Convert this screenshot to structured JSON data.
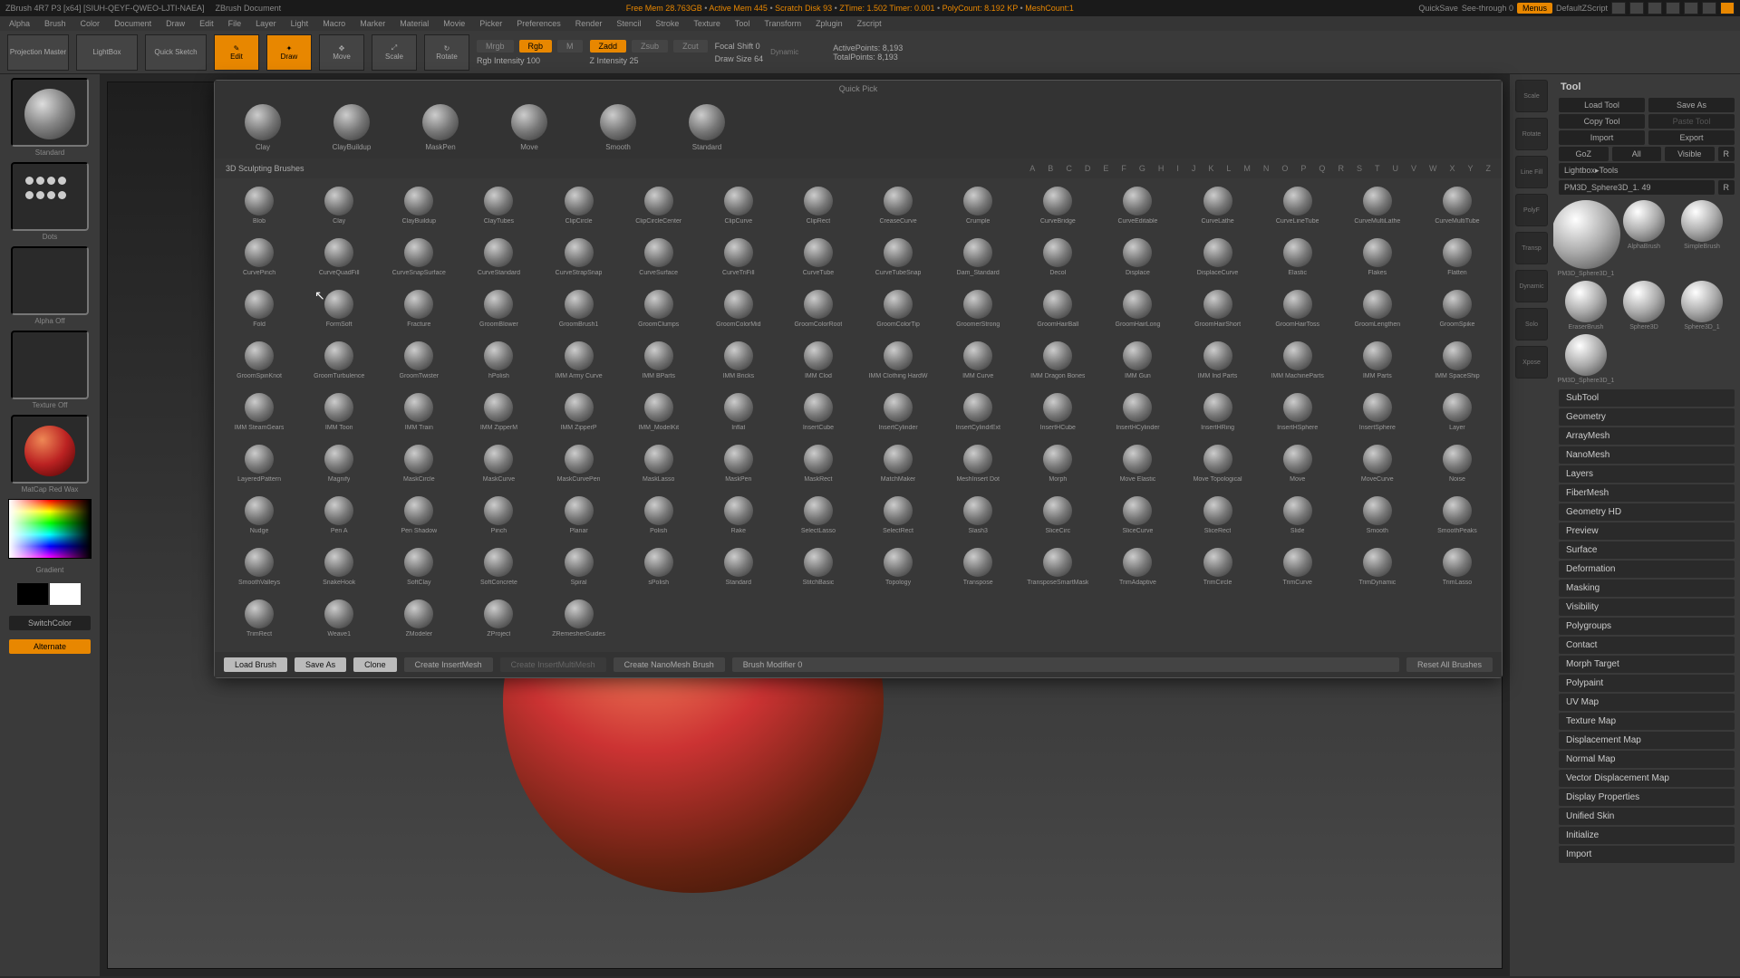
{
  "topbar": {
    "title": "ZBrush 4R7 P3 [x64] [SIUH-QEYF-QWEO-LJTI-NAEA]",
    "doc": "ZBrush Document",
    "stats": [
      "Free Mem 28.763GB",
      "Active Mem 445",
      "Scratch Disk 93",
      "ZTime: 1.502 Timer: 0.001",
      "PolyCount: 8.192 KP",
      "MeshCount:1"
    ],
    "quicksave": "QuickSave",
    "seethrough": "See-through   0",
    "menus": "Menus",
    "script": "DefaultZScript"
  },
  "menubar": [
    "Alpha",
    "Brush",
    "Color",
    "Document",
    "Draw",
    "Edit",
    "File",
    "Layer",
    "Light",
    "Macro",
    "Marker",
    "Material",
    "Movie",
    "Picker",
    "Preferences",
    "Render",
    "Stencil",
    "Stroke",
    "Texture",
    "Tool",
    "Transform",
    "Zplugin",
    "Zscript"
  ],
  "toolbar": {
    "projection": "Projection Master",
    "lightbox": "LightBox",
    "quicksketch": "Quick Sketch",
    "edit": "Edit",
    "draw": "Draw",
    "move": "Move",
    "scale": "Scale",
    "rotate": "Rotate",
    "mrgb": "Mrgb",
    "rgb": "Rgb",
    "m": "M",
    "rgb_int": "Rgb Intensity 100",
    "zadd": "Zadd",
    "zsub": "Zsub",
    "zcut": "Zcut",
    "z_int": "Z Intensity 25",
    "focal": "Focal Shift 0",
    "drawsize": "Draw Size 64",
    "dynamic": "Dynamic",
    "active_pts": "ActivePoints: 8,193",
    "total_pts": "TotalPoints: 8,193"
  },
  "left": {
    "brush_lbl": "Standard",
    "stroke_lbl": "Dots",
    "alpha_lbl": "Alpha Off",
    "texture_lbl": "Texture Off",
    "material_lbl": "MatCap Red Wax",
    "gradient": "Gradient",
    "switch": "SwitchColor",
    "alternate": "Alternate"
  },
  "overlay": {
    "quick_pick": "Quick Pick",
    "quick_brushes": [
      "Clay",
      "ClayBuildup",
      "MaskPen",
      "Move",
      "Smooth",
      "Standard"
    ],
    "section": "3D Sculpting Brushes",
    "alpha": [
      "A",
      "B",
      "C",
      "D",
      "E",
      "F",
      "G",
      "H",
      "I",
      "J",
      "K",
      "L",
      "M",
      "N",
      "O",
      "P",
      "Q",
      "R",
      "S",
      "T",
      "U",
      "V",
      "W",
      "X",
      "Y",
      "Z"
    ],
    "brushes": [
      "Blob",
      "Clay",
      "ClayBuildup",
      "ClayTubes",
      "ClipCircle",
      "ClipCircleCenter",
      "ClipCurve",
      "ClipRect",
      "CreaseCurve",
      "Crumple",
      "CurveBridge",
      "CurveEditable",
      "CurveLathe",
      "CurveLineTube",
      "CurveMultiLathe",
      "CurveMultiTube",
      "CurvePinch",
      "CurveQuadFill",
      "CurveSnapSurface",
      "CurveStandard",
      "CurveStrapSnap",
      "CurveSurface",
      "CurveTriFill",
      "CurveTube",
      "CurveTubeSnap",
      "Dam_Standard",
      "Decol",
      "Displace",
      "DisplaceCurve",
      "Elastic",
      "Flakes",
      "Flatten",
      "Fold",
      "FormSoft",
      "Fracture",
      "GroomBlower",
      "GroomBrush1",
      "GroomClumps",
      "GroomColorMid",
      "GroomColorRoot",
      "GroomColorTip",
      "GroomerStrong",
      "GroomHairBall",
      "GroomHairLong",
      "GroomHairShort",
      "GroomHairToss",
      "GroomLengthen",
      "GroomSpike",
      "GroomSpinKnot",
      "GroomTurbulence",
      "GroomTwister",
      "hPolish",
      "IMM Army Curve",
      "IMM BParts",
      "IMM Bricks",
      "IMM Clod",
      "IMM Clothing HardW",
      "IMM Curve",
      "IMM Dragon Bones",
      "IMM Gun",
      "IMM Ind Parts",
      "IMM MachineParts",
      "IMM Parts",
      "IMM SpaceShip",
      "IMM SteamGears",
      "IMM Toon",
      "IMM Train",
      "IMM ZipperM",
      "IMM ZipperP",
      "IMM_ModelKit",
      "Inflat",
      "InsertCube",
      "InsertCylinder",
      "InsertCylindrExt",
      "InsertHCube",
      "InsertHCylinder",
      "InsertHRing",
      "InsertHSphere",
      "InsertSphere",
      "Layer",
      "LayeredPattern",
      "Magnify",
      "MaskCircle",
      "MaskCurve",
      "MaskCurvePen",
      "MaskLasso",
      "MaskPen",
      "MaskRect",
      "MatchMaker",
      "MeshInsert Dot",
      "Morph",
      "Move Elastic",
      "Move Topological",
      "Move",
      "MoveCurve",
      "Noise",
      "Nudge",
      "Pen A",
      "Pen Shadow",
      "Pinch",
      "Planar",
      "Polish",
      "Rake",
      "SelectLasso",
      "SelectRect",
      "Slash3",
      "SliceCirc",
      "SliceCurve",
      "SliceRect",
      "Slide",
      "Smooth",
      "SmoothPeaks",
      "SmoothValleys",
      "SnakeHook",
      "SoftClay",
      "SoftConcrete",
      "Spiral",
      "sPolish",
      "Standard",
      "StitchBasic",
      "Topology",
      "Transpose",
      "TransposeSmartMask",
      "TrimAdaptive",
      "TrimCircle",
      "TrimCurve",
      "TrimDynamic",
      "TrimLasso",
      "TrimRect",
      "Weave1",
      "ZModeler",
      "ZProject",
      "ZRemesherGuides"
    ],
    "footer": {
      "load": "Load Brush",
      "save": "Save As",
      "clone": "Clone",
      "create_insert": "Create InsertMesh",
      "create_multi": "Create InsertMultiMesh",
      "create_nano": "Create NanoMesh Brush",
      "modifier": "Brush Modifier 0",
      "reset": "Reset All Brushes"
    }
  },
  "right_tools": [
    "Scale",
    "Rotate",
    "Line Fill",
    "PolyF",
    "Transp",
    "Dynamic",
    "Solo",
    "Xpose"
  ],
  "right": {
    "title": "Tool",
    "load": "Load Tool",
    "saveas": "Save As",
    "copy": "Copy Tool",
    "paste": "Paste Tool",
    "import": "Import",
    "export": "Export",
    "goz": "GoZ",
    "all": "All",
    "visible": "Visible",
    "r": "R",
    "lightbox": "Lightbox▸Tools",
    "current": "PM3D_Sphere3D_1. 49",
    "thumbs": [
      "PM3D_Sphere3D_1",
      "AlphaBrush",
      "SimpleBrush",
      "EraserBrush",
      "Sphere3D",
      "Sphere3D_1",
      "PM3D_Sphere3D_1"
    ],
    "accordion": [
      "SubTool",
      "Geometry",
      "ArrayMesh",
      "NanoMesh",
      "Layers",
      "FiberMesh",
      "Geometry HD",
      "Preview",
      "Surface",
      "Deformation",
      "Masking",
      "Visibility",
      "Polygroups",
      "Contact",
      "Morph Target",
      "Polypaint",
      "UV Map",
      "Texture Map",
      "Displacement Map",
      "Normal Map",
      "Vector Displacement Map",
      "Display Properties",
      "Unified Skin",
      "Initialize",
      "Import"
    ]
  }
}
